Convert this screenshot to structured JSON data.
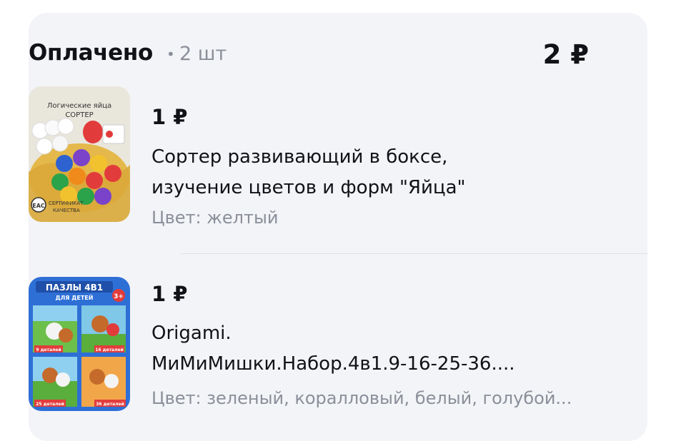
{
  "order": {
    "status_title": "Оплачено",
    "separator": "•",
    "quantity": "2 шт",
    "total": "2 ₽"
  },
  "items": [
    {
      "price": "1 ₽",
      "name_lines": [
        "Сортер развивающий в боксе,",
        "изучение цветов и форм \"Яйца\""
      ],
      "meta": "Цвет: желтый",
      "thumb": {
        "title_line1": "Логические яйца",
        "title_line2": "СОРТЕР",
        "badge": "EAC",
        "cert_line1": "СЕРТИФИКАТ",
        "cert_line2": "КАЧЕСТВА"
      }
    },
    {
      "price": "1 ₽",
      "name_lines": [
        "Origami.",
        "МиМиМишки.Набор.4в1.9-16-25-36...."
      ],
      "meta": "Цвет: зеленый, коралловый, белый, голубой...",
      "thumb": {
        "title_line1": "ПАЗЛЫ 4В1",
        "title_line2": "ДЛЯ ДЕТЕЙ",
        "age": "3+",
        "labels": [
          "9 деталей",
          "16 деталей",
          "25 деталей",
          "36 деталей"
        ]
      }
    }
  ]
}
